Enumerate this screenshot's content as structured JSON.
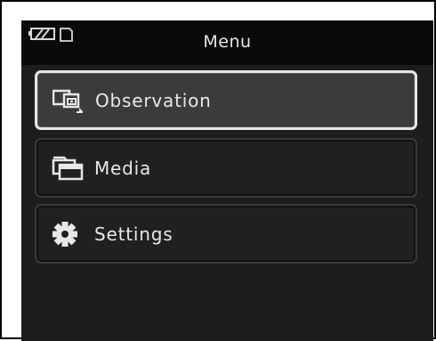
{
  "header": {
    "title": "Menu"
  },
  "status": {
    "battery_icon": "battery-icon",
    "memory_card_icon": "memory-card-icon"
  },
  "menu": {
    "items": [
      {
        "label": "Observation",
        "icon": "observation-icon",
        "selected": true
      },
      {
        "label": "Media",
        "icon": "media-icon",
        "selected": false
      },
      {
        "label": "Settings",
        "icon": "gear-icon",
        "selected": false
      }
    ]
  },
  "colors": {
    "screen_bg": "#1d1d1d",
    "header_bg": "#0a0a0a",
    "selected_border": "#e6e6e6",
    "text": "#e8e8e8"
  }
}
